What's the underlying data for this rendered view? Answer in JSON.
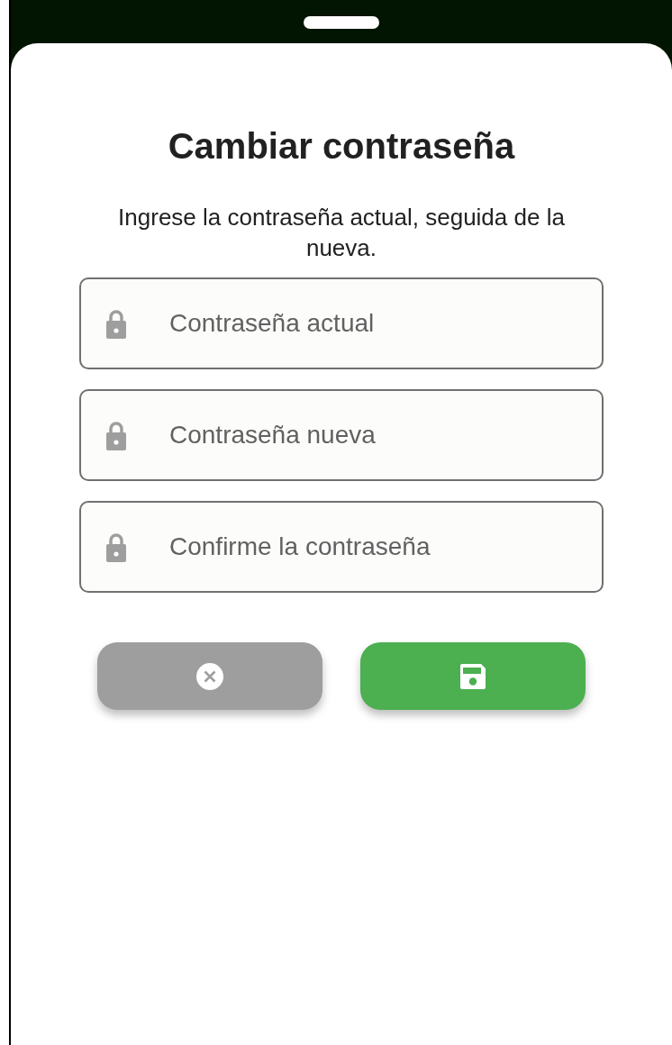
{
  "dialog": {
    "title": "Cambiar contraseña",
    "description": "Ingrese la contraseña actual, seguida de la nueva.",
    "fields": [
      {
        "placeholder": "Contraseña actual"
      },
      {
        "placeholder": "Contraseña nueva"
      },
      {
        "placeholder": "Confirme la contraseña"
      }
    ],
    "buttons": [
      {
        "kind": "cancel"
      },
      {
        "kind": "save"
      }
    ]
  }
}
